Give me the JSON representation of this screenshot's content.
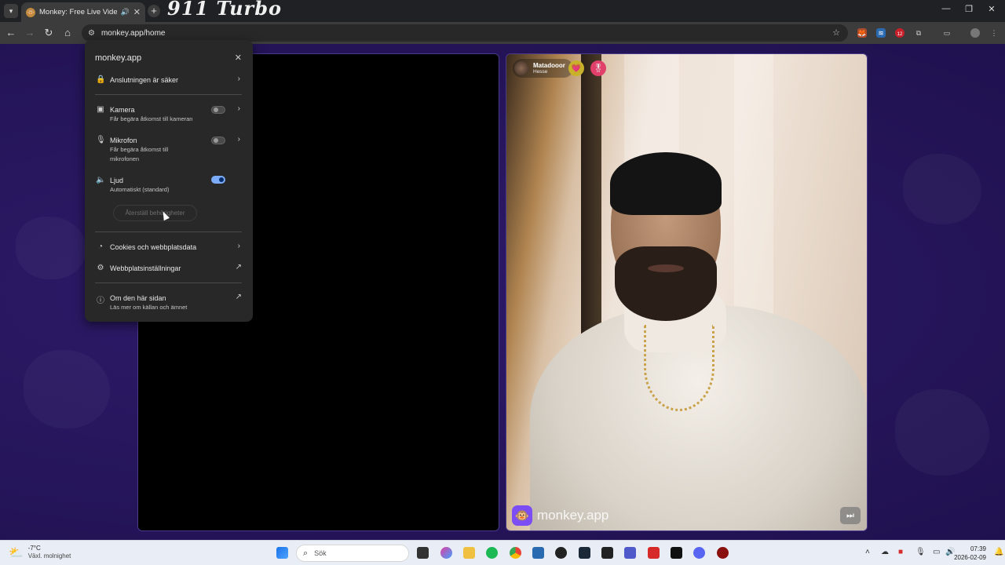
{
  "browser": {
    "tab": {
      "title": "Monkey: Free Live Video Ch",
      "favicon": "monkey-favicon",
      "audio_icon": "🔊",
      "close_icon": "✕"
    },
    "new_tab_icon": "+",
    "banner_text": "911 Turbo",
    "window_controls": {
      "minimize": "—",
      "maximize": "❐",
      "close": "✕"
    },
    "nav": {
      "back": "←",
      "forward": "→",
      "reload": "↻",
      "home": "⌂"
    },
    "url": "monkey.app/home",
    "bookmark_icon": "☆",
    "extension_badge": "12",
    "menu_icon": "⋮"
  },
  "site_info": {
    "title": "monkey.app",
    "close_icon": "✕",
    "connection": {
      "label": "Anslutningen är säker",
      "icon": "lock-icon"
    },
    "camera": {
      "label": "Kamera",
      "sub": "Får begära åtkomst till kameran",
      "enabled": false
    },
    "microphone": {
      "label": "Mikrofon",
      "sub": "Får begära åtkomst till mikrofonen",
      "enabled": false
    },
    "sound": {
      "label": "Ljud",
      "sub": "Automatiskt (standard)",
      "enabled": true
    },
    "reset_button": "Återställ behörigheter",
    "cookies": {
      "label": "Cookies och webbplatsdata"
    },
    "site_settings": {
      "label": "Webbplatsinställningar"
    },
    "about": {
      "label": "Om den här sidan",
      "sub": "Läs mer om källan och ämnet"
    }
  },
  "video": {
    "user_name": "Matadooor",
    "user_location": "Hesse",
    "badge_heart_icon": "💗",
    "badge_medal_icon": "🎖",
    "watermark_logo": "🐵",
    "watermark_text": "monkey.app",
    "skip_icon": "⏭"
  },
  "taskbar": {
    "weather_temp": "-7°C",
    "weather_condition": "Växl. molnighet",
    "search_placeholder": "Sök",
    "time": "07:39",
    "date": "2026-02-09"
  },
  "colors": {
    "page_background": "#2a1760",
    "toggle_on": "#7cacf8",
    "brand_purple": "#7b4df2"
  }
}
